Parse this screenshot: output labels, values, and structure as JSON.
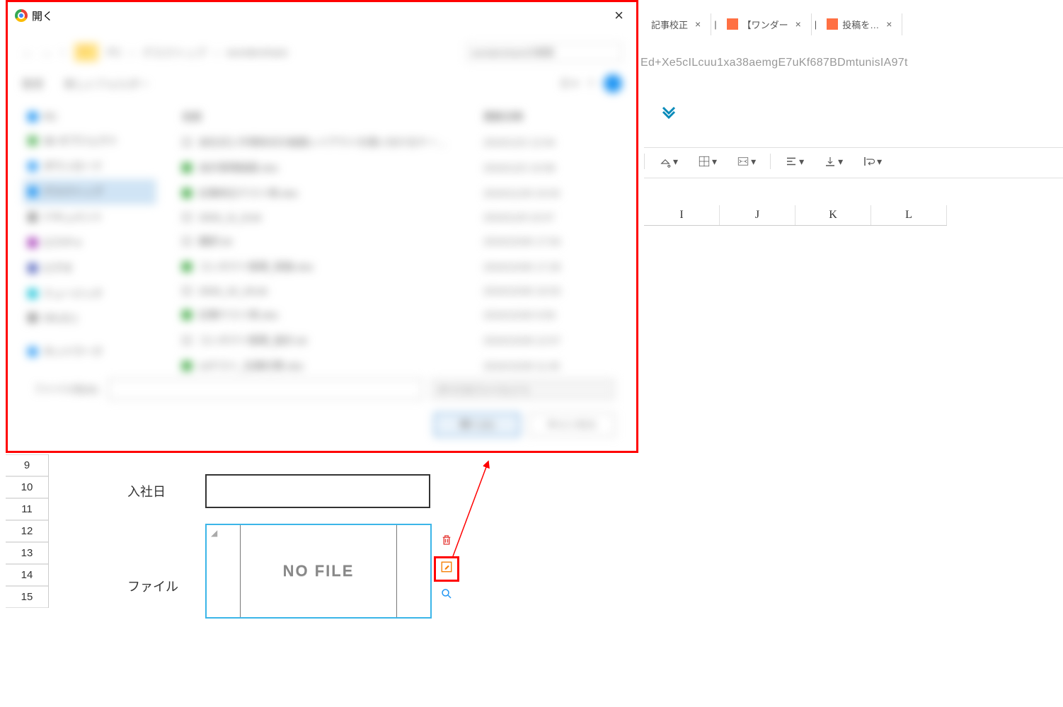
{
  "dialog": {
    "title": "開く",
    "breadcrumb": [
      "PC",
      "デスクトップ",
      "wondershare"
    ],
    "search_placeholder": "wondershareの検索",
    "toolbar_left": [
      "整理",
      "新しいフォルダー"
    ],
    "sidebar": [
      {
        "label": "PC",
        "color": "#2196f3"
      },
      {
        "label": "3D オブジェクト",
        "color": "#66bb6a"
      },
      {
        "label": "ダウンロード",
        "color": "#42a5f5"
      },
      {
        "label": "デスクトップ",
        "color": "#2196f3",
        "selected": true
      },
      {
        "label": "ドキュメント",
        "color": "#9e9e9e"
      },
      {
        "label": "ピクチャ",
        "color": "#ab47bc"
      },
      {
        "label": "ビデオ",
        "color": "#5c6bc0"
      },
      {
        "label": "ミュージック",
        "color": "#26c6da"
      },
      {
        "label": "OS (C:)",
        "color": "#9e9e9e"
      },
      {
        "label": "ネットワーク",
        "color": "#42a5f5"
      }
    ],
    "columns": {
      "name": "名前",
      "date": "更新日時"
    },
    "files": [
      {
        "icon": "gray",
        "name": "会社式と半導体式の画面レイアウトを使い分けるケー…",
        "date": "2024/12/2 12:04"
      },
      {
        "icon": "green",
        "name": "会計管理画面.xlsx",
        "date": "2024/12/2 10:58"
      },
      {
        "icon": "green",
        "name": "記事修正テスト用.xlsx",
        "date": "2024/11/29 15:03"
      },
      {
        "icon": "gray",
        "name": "2024_11_8.txt",
        "date": "2024/11/8 10:07"
      },
      {
        "icon": "gray",
        "name": "翻訳.txt",
        "date": "2024/10/30 17:54"
      },
      {
        "icon": "green",
        "name": "コンタクト管理_実施.xlsx",
        "date": "2024/10/30 17:28"
      },
      {
        "icon": "gray",
        "name": "2024_10_16.txt",
        "date": "2024/10/30 15:53"
      },
      {
        "icon": "green",
        "name": "記事テスト用.xlsx",
        "date": "2024/10/30 9:59"
      },
      {
        "icon": "gray",
        "name": "コンタクト管理_設計.txt",
        "date": "2024/10/28 12:57"
      },
      {
        "icon": "green",
        "name": "UIテスト_在庫計算.xlsx",
        "date": "2024/10/28 11:45"
      }
    ],
    "filename_label": "ファイル名(N):",
    "filetype": "すべてのファイル (*.*)",
    "open_button": "開く(O)",
    "cancel_button": "キャンセル"
  },
  "browser_tabs": [
    {
      "label": "記事校正"
    },
    {
      "label": "【ワンダー"
    },
    {
      "label": "投稿を…"
    }
  ],
  "url_fragment": "Ed+Xe5cILcuu1xa38aemgE7uKf687BDmtunisIA97t",
  "spreadsheet": {
    "columns": [
      "I",
      "J",
      "K",
      "L"
    ],
    "rows": [
      "9",
      "10",
      "11",
      "12",
      "13",
      "14",
      "15"
    ],
    "form": {
      "date_label": "入社日",
      "file_label": "ファイル",
      "no_file": "NO FILE"
    }
  }
}
